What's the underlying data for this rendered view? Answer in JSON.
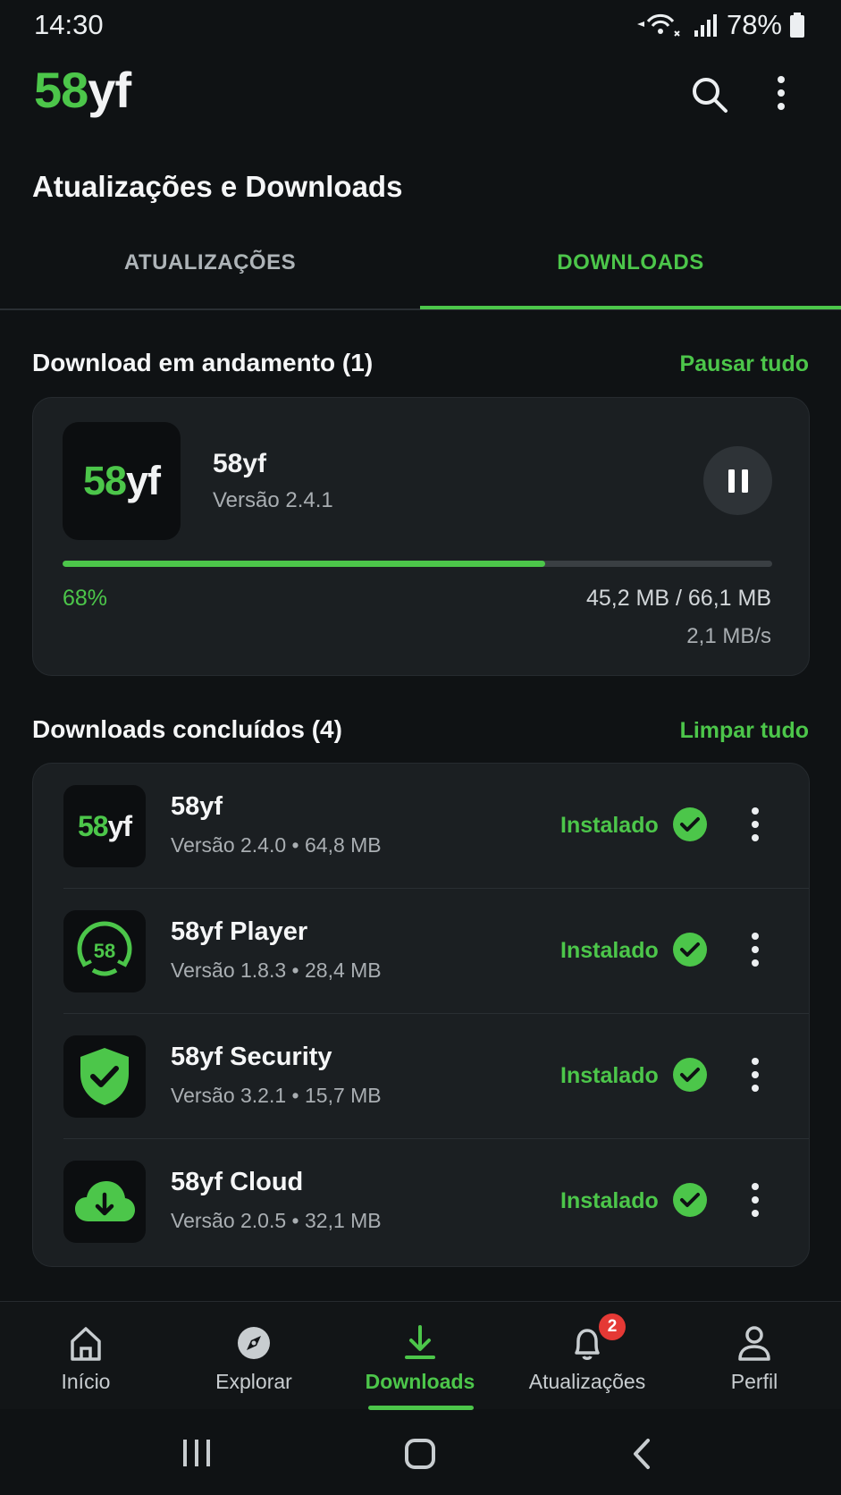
{
  "status_bar": {
    "time": "14:30",
    "battery": "78%"
  },
  "header": {
    "brand_num": "58",
    "brand_txt": "yf",
    "title": "Atualizações e Downloads"
  },
  "tabs": [
    {
      "label": "ATUALIZAÇÕES",
      "active": false
    },
    {
      "label": "DOWNLOADS",
      "active": true
    }
  ],
  "active_section": {
    "title": "Download em andamento (1)",
    "action": "Pausar tudo"
  },
  "active_download": {
    "name": "58yf",
    "version": "Versão 2.4.1",
    "progress": 0.68,
    "progress_label": "68%",
    "size": "45,2 MB / 66,1 MB",
    "speed": "2,1 MB/s"
  },
  "done_section": {
    "title": "Downloads concluídos (4)",
    "action": "Limpar tudo"
  },
  "downloads": [
    {
      "name": "58yf",
      "meta": "Versão 2.4.0 • 64,8 MB",
      "status": "Instalado",
      "icon": "58yf-logo-icon"
    },
    {
      "name": "58yf Player",
      "meta": "Versão 1.8.3 • 28,4 MB",
      "status": "Instalado",
      "icon": "player-58-icon",
      "icon_text": "58"
    },
    {
      "name": "58yf Security",
      "meta": "Versão 3.2.1 • 15,7 MB",
      "status": "Instalado",
      "icon": "shield-check-icon"
    },
    {
      "name": "58yf Cloud",
      "meta": "Versão 2.0.5 • 32,1 MB",
      "status": "Instalado",
      "icon": "cloud-download-icon"
    }
  ],
  "bottom_nav": [
    {
      "label": "Início",
      "icon": "home-icon"
    },
    {
      "label": "Explorar",
      "icon": "compass-icon"
    },
    {
      "label": "Downloads",
      "icon": "download-icon",
      "active": true
    },
    {
      "label": "Atualizações",
      "icon": "bell-icon",
      "badge": "2"
    },
    {
      "label": "Perfil",
      "icon": "user-icon"
    }
  ],
  "colors": {
    "accent": "#4cc64a",
    "background": "#0f1214",
    "card": "#1b1f22",
    "badge": "#e53935"
  }
}
